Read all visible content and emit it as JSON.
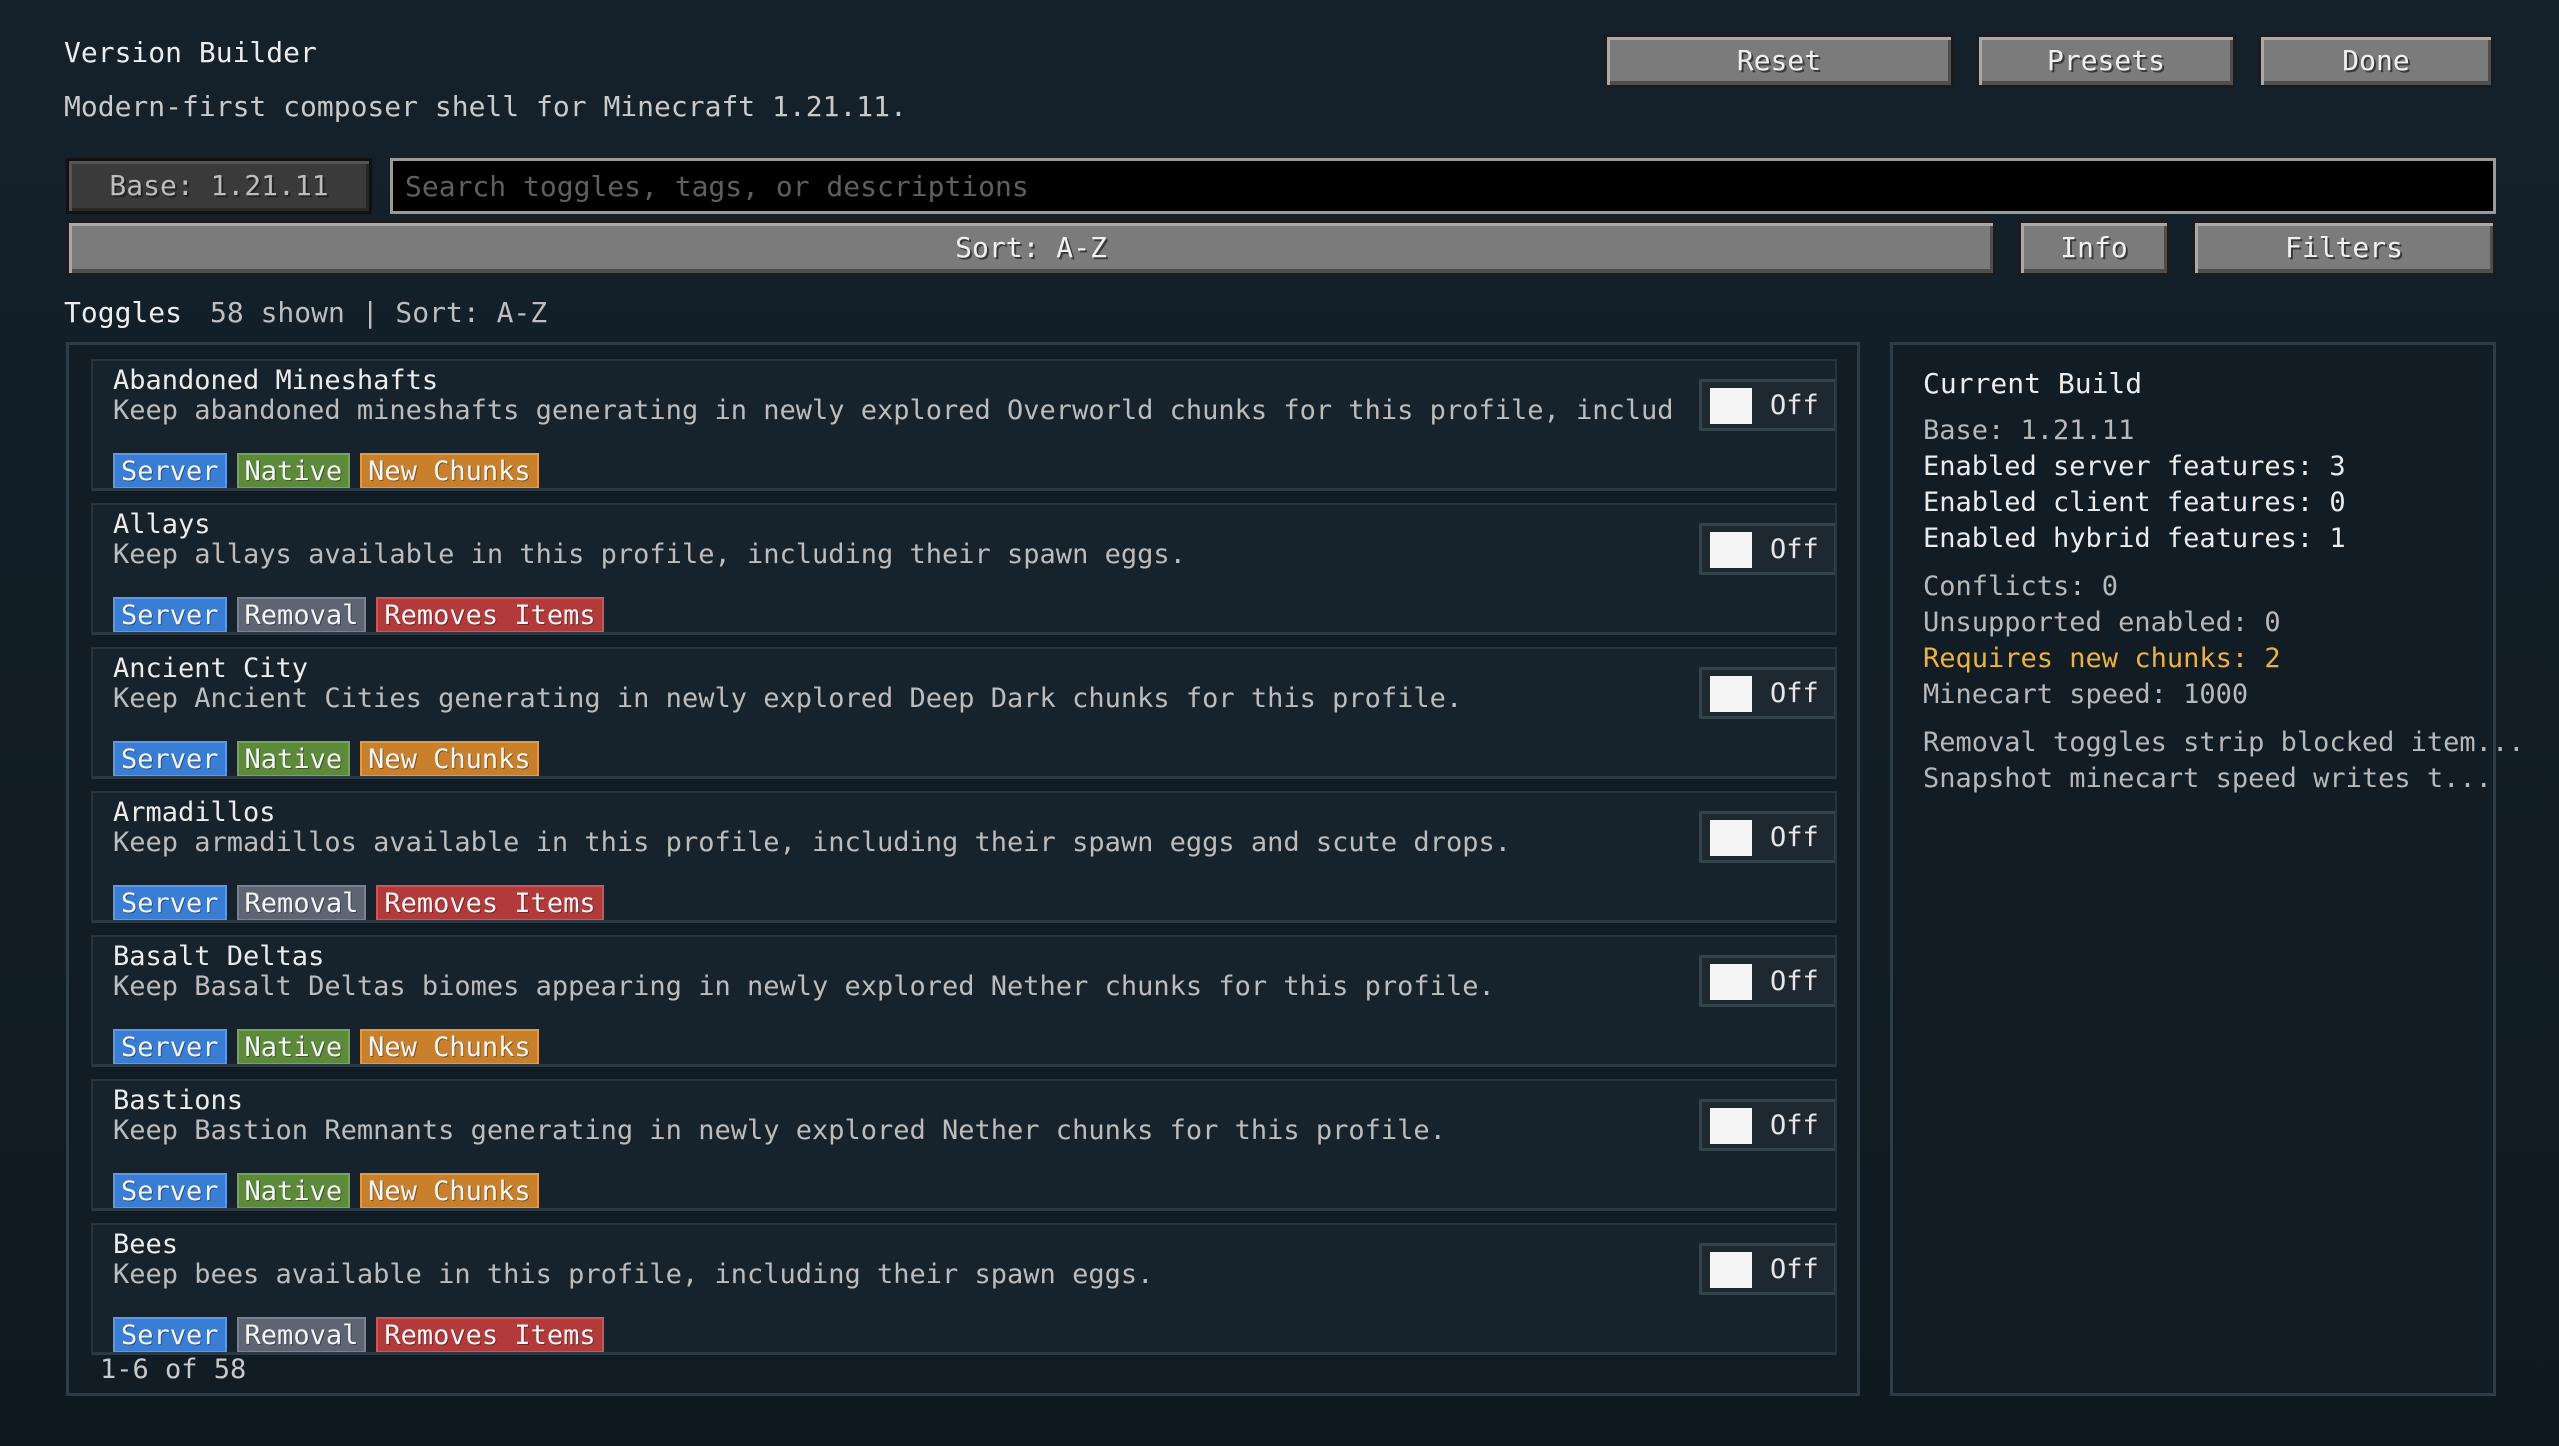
{
  "header": {
    "title": "Version Builder",
    "subtitle": "Modern-first composer shell for Minecraft 1.21.11."
  },
  "toolbar": {
    "reset_label": "Reset",
    "presets_label": "Presets",
    "done_label": "Done",
    "base_label": "Base: 1.21.11",
    "search_placeholder": "Search toggles, tags, or descriptions",
    "search_value": "",
    "sort_label": "Sort: A-Z",
    "info_label": "Info",
    "filters_label": "Filters"
  },
  "toggles": {
    "label": "Toggles",
    "count_text": "58 shown | Sort: A-Z",
    "pager_text": "1-6 of 58",
    "items": [
      {
        "title": "Abandoned Mineshafts",
        "description": "Keep abandoned mineshafts generating in newly explored Overworld chunks for this profile, includi...",
        "state": "Off",
        "tags": [
          {
            "label": "Server",
            "kind": "server"
          },
          {
            "label": "Native",
            "kind": "native"
          },
          {
            "label": "New Chunks",
            "kind": "chunks"
          }
        ]
      },
      {
        "title": "Allays",
        "description": "Keep allays available in this profile, including their spawn eggs.",
        "state": "Off",
        "tags": [
          {
            "label": "Server",
            "kind": "server"
          },
          {
            "label": "Removal",
            "kind": "removal"
          },
          {
            "label": "Removes Items",
            "kind": "items"
          }
        ]
      },
      {
        "title": "Ancient City",
        "description": "Keep Ancient Cities generating in newly explored Deep Dark chunks for this profile.",
        "state": "Off",
        "tags": [
          {
            "label": "Server",
            "kind": "server"
          },
          {
            "label": "Native",
            "kind": "native"
          },
          {
            "label": "New Chunks",
            "kind": "chunks"
          }
        ]
      },
      {
        "title": "Armadillos",
        "description": "Keep armadillos available in this profile, including their spawn eggs and scute drops.",
        "state": "Off",
        "tags": [
          {
            "label": "Server",
            "kind": "server"
          },
          {
            "label": "Removal",
            "kind": "removal"
          },
          {
            "label": "Removes Items",
            "kind": "items"
          }
        ]
      },
      {
        "title": "Basalt Deltas",
        "description": "Keep Basalt Deltas biomes appearing in newly explored Nether chunks for this profile.",
        "state": "Off",
        "tags": [
          {
            "label": "Server",
            "kind": "server"
          },
          {
            "label": "Native",
            "kind": "native"
          },
          {
            "label": "New Chunks",
            "kind": "chunks"
          }
        ]
      },
      {
        "title": "Bastions",
        "description": "Keep Bastion Remnants generating in newly explored Nether chunks for this profile.",
        "state": "Off",
        "tags": [
          {
            "label": "Server",
            "kind": "server"
          },
          {
            "label": "Native",
            "kind": "native"
          },
          {
            "label": "New Chunks",
            "kind": "chunks"
          }
        ]
      },
      {
        "title": "Bees",
        "description": "Keep bees available in this profile, including their spawn eggs.",
        "state": "Off",
        "tags": [
          {
            "label": "Server",
            "kind": "server"
          },
          {
            "label": "Removal",
            "kind": "removal"
          },
          {
            "label": "Removes Items",
            "kind": "items"
          }
        ]
      }
    ]
  },
  "current_build": {
    "title": "Current Build",
    "base": "Base: 1.21.11",
    "server_features": "Enabled server features: 3",
    "client_features": "Enabled client features: 0",
    "hybrid_features": "Enabled hybrid features: 1",
    "conflicts": "Conflicts: 0",
    "unsupported": "Unsupported enabled: 0",
    "new_chunks": "Requires new chunks: 2",
    "minecart_speed": "Minecart speed: 1000",
    "note_1": "Removal toggles strip blocked item...",
    "note_2": "Snapshot minecart speed writes t..."
  },
  "colors": {
    "background": "#101a22",
    "warning": "#f0b23c",
    "tag_server": "#3a7dd4",
    "tag_native": "#5c8a3a",
    "tag_chunks": "#c8802c",
    "tag_removal": "#5d6572",
    "tag_items": "#b23a3a"
  }
}
